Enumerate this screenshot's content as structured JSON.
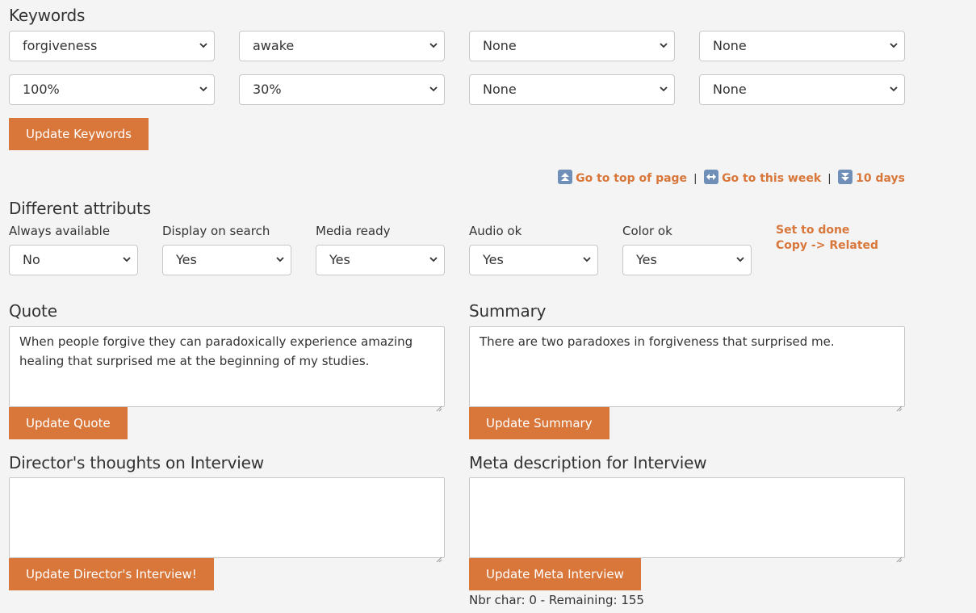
{
  "keywords": {
    "title": "Keywords",
    "row1": [
      "forgiveness",
      "awake",
      "None",
      "None"
    ],
    "row2": [
      "100%",
      "30%",
      "None",
      "None"
    ],
    "update_label": "Update Keywords"
  },
  "nav": {
    "top_label": "Go to top of page",
    "week_label": "Go to this week",
    "days_label": "10 days",
    "separator": "|"
  },
  "attributes": {
    "title": "Different attributs",
    "items": [
      {
        "label": "Always available",
        "value": "No"
      },
      {
        "label": "Display on search",
        "value": "Yes"
      },
      {
        "label": "Media ready",
        "value": "Yes"
      },
      {
        "label": "Audio ok",
        "value": "Yes"
      },
      {
        "label": "Color ok",
        "value": "Yes"
      }
    ],
    "set_done_label": "Set to done",
    "copy_related_label": "Copy -> Related"
  },
  "quote": {
    "title": "Quote",
    "text": "When people forgive they can paradoxically experience amazing healing that surprised me at the beginning of my studies.",
    "update_label": "Update Quote"
  },
  "summary": {
    "title": "Summary",
    "text": "There are two paradoxes in forgiveness that surprised me.",
    "update_label": "Update Summary"
  },
  "director": {
    "title": "Director's thoughts on Interview",
    "text": "",
    "update_label": "Update Director's Interview!"
  },
  "meta": {
    "title": "Meta description for Interview",
    "text": "",
    "update_label": "Update Meta Interview",
    "counter": "Nbr char: 0 - Remaining: 155"
  },
  "colors": {
    "accent": "#d9773b",
    "background": "#f4f4f4"
  }
}
